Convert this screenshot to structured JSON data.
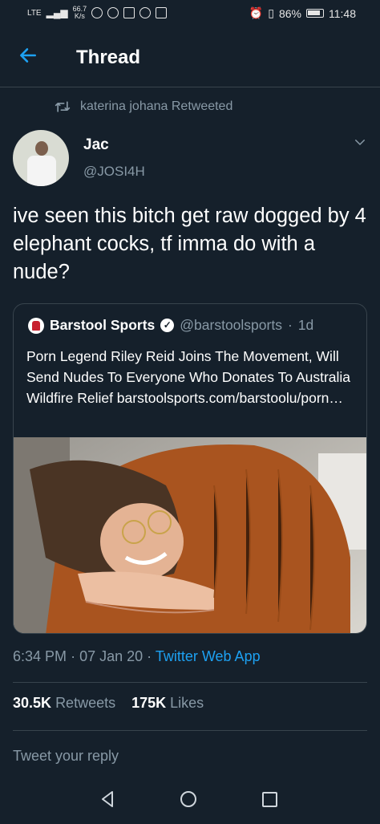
{
  "status_bar": {
    "carrier": "LTE",
    "net_speed_value": "66.7",
    "net_speed_unit": "K/s",
    "battery": "86%",
    "time": "11:48"
  },
  "header": {
    "title": "Thread"
  },
  "retweet": {
    "text": "katerina johana Retweeted"
  },
  "tweet": {
    "display_name": "Jac",
    "handle": "@JOSI4H",
    "text": "ive seen this bitch get raw dogged by 4 elephant cocks, tf imma do with a nude?"
  },
  "quote": {
    "name": "Barstool Sports",
    "handle": "@barstoolsports",
    "separator": "·",
    "time": "1d",
    "text": "Porn Legend Riley Reid Joins The Movement, Will Send Nudes To Everyone Who Donates To Australia Wildfire Relief barstoolsports.com/barstoolu/porn…"
  },
  "timestamp": {
    "time": "6:34 PM",
    "sep1": "·",
    "date": "07 Jan 20",
    "sep2": "·",
    "app": "Twitter Web App"
  },
  "stats": {
    "retweets_count": "30.5K",
    "retweets_label": "Retweets",
    "likes_count": "175K",
    "likes_label": "Likes"
  },
  "reply": {
    "placeholder": "Tweet your reply"
  },
  "icons": {
    "back": "arrow-left-icon",
    "retweet": "retweet-icon",
    "chevron": "chevron-down-icon",
    "verified": "verified-badge-icon"
  },
  "colors": {
    "background": "#15202b",
    "accent": "#1da1f2",
    "secondary_text": "#8899a6",
    "divider": "#38444d"
  }
}
